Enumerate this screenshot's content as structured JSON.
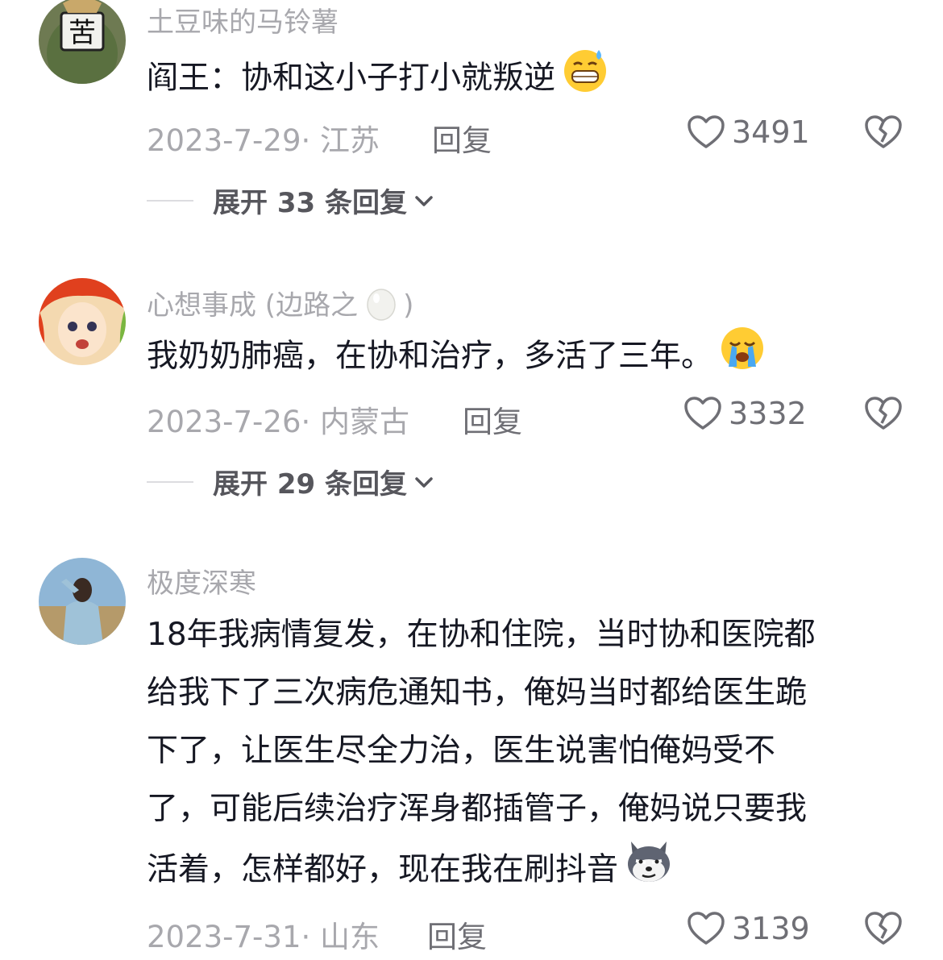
{
  "comments": [
    {
      "username": "土豆味的马铃薯",
      "text": "阎王：协和这小子打小就叛逆",
      "emoji": "grin-sweat-emoji",
      "date": "2023-7-29",
      "location": "江苏",
      "reply_label": "回复",
      "likes": "3491",
      "expand_label": "展开 33 条回复"
    },
    {
      "username_prefix": "心想事成 (边路之",
      "username_suffix": ")",
      "username_icon": "egg-icon",
      "text": "我奶奶肺癌，在协和治疗，多活了三年。",
      "emoji": "crying-emoji",
      "date": "2023-7-26",
      "location": "内蒙古",
      "reply_label": "回复",
      "likes": "3332",
      "expand_label": "展开 29 条回复"
    },
    {
      "username": "极度深寒",
      "text_lines": [
        "18年我病情复发，在协和住院，当时协和医院都",
        "给我下了三次病危通知书，俺妈当时都给医生跪",
        "下了，让医生尽全力治，医生说害怕俺妈受不",
        "了，可能后续治疗浑身都插管子，俺妈说只要我",
        "活着，怎样都好，现在我在刷抖音"
      ],
      "emoji": "smug-husky-emoji",
      "date": "2023-7-31",
      "location": "山东",
      "reply_label": "回复",
      "likes": "3139"
    }
  ],
  "meta_separator": "·",
  "colors": {
    "text": "#161823",
    "muted": "#a8a8ad",
    "secondary": "#6f6f75"
  }
}
